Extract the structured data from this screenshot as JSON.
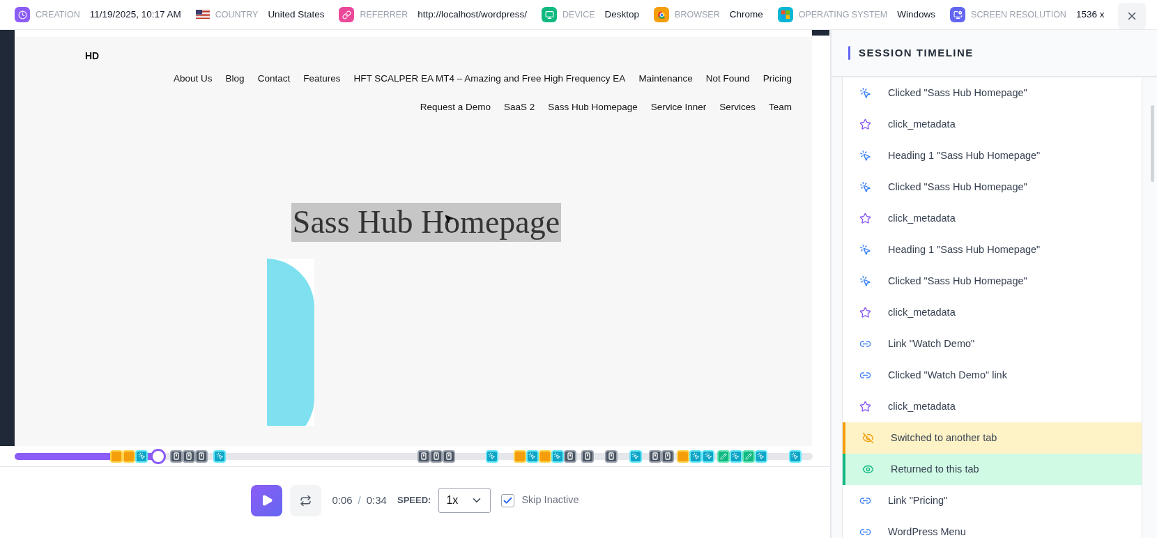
{
  "info_bar": [
    {
      "kind": "creation",
      "label": "CREATION",
      "value": "11/19/2025, 10:17 AM"
    },
    {
      "kind": "country",
      "label": "COUNTRY",
      "value": "United States"
    },
    {
      "kind": "referrer",
      "label": "REFERRER",
      "value": "http://localhost/wordpress/"
    },
    {
      "kind": "device",
      "label": "DEVICE",
      "value": "Desktop"
    },
    {
      "kind": "browser",
      "label": "BROWSER",
      "value": "Chrome"
    },
    {
      "kind": "os",
      "label": "OPERATING SYSTEM",
      "value": "Windows"
    },
    {
      "kind": "resolution",
      "label": "SCREEN RESOLUTION",
      "value": "1536 x"
    }
  ],
  "replay": {
    "site_logo": "HD",
    "nav_row_1": [
      "About Us",
      "Blog",
      "Contact",
      "Features",
      "HFT SCALPER EA MT4 – Amazing and Free High Frequency EA",
      "Maintenance",
      "Not Found",
      "Pricing"
    ],
    "nav_row_2": [
      "Request a Demo",
      "SaaS 2",
      "Sass Hub Homepage",
      "Service Inner",
      "Services",
      "Team"
    ],
    "heading": "Sass Hub Homepage",
    "heading_highlighted": true
  },
  "timeline": {
    "level": 0.18,
    "marker_groups": [
      {
        "markers": [
          {
            "kind": "tab"
          },
          {
            "kind": "tab"
          },
          {
            "kind": "click"
          }
        ]
      },
      {
        "markers": [
          {
            "kind": "field"
          },
          {
            "kind": "field"
          },
          {
            "kind": "field"
          }
        ]
      },
      {
        "markers": [
          {
            "kind": "click"
          }
        ]
      },
      {
        "markers": [
          {
            "kind": "field"
          },
          {
            "kind": "field"
          },
          {
            "kind": "field"
          }
        ]
      },
      {
        "markers": [
          {
            "kind": "click"
          }
        ]
      },
      {
        "markers": [
          {
            "kind": "tab"
          },
          {
            "kind": "click"
          },
          {
            "kind": "tab"
          },
          {
            "kind": "click"
          },
          {
            "kind": "field"
          }
        ]
      },
      {
        "markers": [
          {
            "kind": "field"
          }
        ]
      },
      {
        "markers": [
          {
            "kind": "field"
          }
        ]
      },
      {
        "markers": [
          {
            "kind": "click"
          }
        ]
      },
      {
        "markers": [
          {
            "kind": "field"
          },
          {
            "kind": "field"
          }
        ]
      },
      {
        "markers": [
          {
            "kind": "tab"
          },
          {
            "kind": "click"
          },
          {
            "kind": "click"
          }
        ]
      },
      {
        "markers": [
          {
            "kind": "input"
          },
          {
            "kind": "click"
          },
          {
            "kind": "input"
          },
          {
            "kind": "click"
          }
        ]
      },
      {
        "markers": [
          {
            "kind": "click"
          }
        ]
      }
    ]
  },
  "controls": {
    "current_time": "0:06",
    "separator": "/",
    "total_time": "0:34",
    "speed_label": "SPEED:",
    "speed": "1x",
    "skip_inactive": {
      "label": "Skip Inactive",
      "checked": true
    }
  },
  "session_timeline": {
    "title": "SESSION TIMELINE",
    "events": [
      {
        "kind": "click",
        "text": "Clicked \"Sass Hub Homepage\""
      },
      {
        "kind": "metadata",
        "text": "click_metadata"
      },
      {
        "kind": "click",
        "text": "Heading 1 \"Sass Hub Homepage\""
      },
      {
        "kind": "click",
        "text": "Clicked \"Sass Hub Homepage\""
      },
      {
        "kind": "metadata",
        "text": "click_metadata"
      },
      {
        "kind": "click",
        "text": "Heading 1 \"Sass Hub Homepage\""
      },
      {
        "kind": "click",
        "text": "Clicked \"Sass Hub Homepage\""
      },
      {
        "kind": "metadata",
        "text": "click_metadata"
      },
      {
        "kind": "link",
        "text": "Link \"Watch Demo\""
      },
      {
        "kind": "link",
        "text": "Clicked \"Watch Demo\" link"
      },
      {
        "kind": "metadata",
        "text": "click_metadata"
      },
      {
        "kind": "tab_hidden",
        "text": "Switched to another tab"
      },
      {
        "kind": "tab_visible",
        "text": "Returned to this tab"
      },
      {
        "kind": "link",
        "text": "Link \"Pricing\""
      },
      {
        "kind": "link",
        "text": "WordPress Menu"
      }
    ]
  }
}
